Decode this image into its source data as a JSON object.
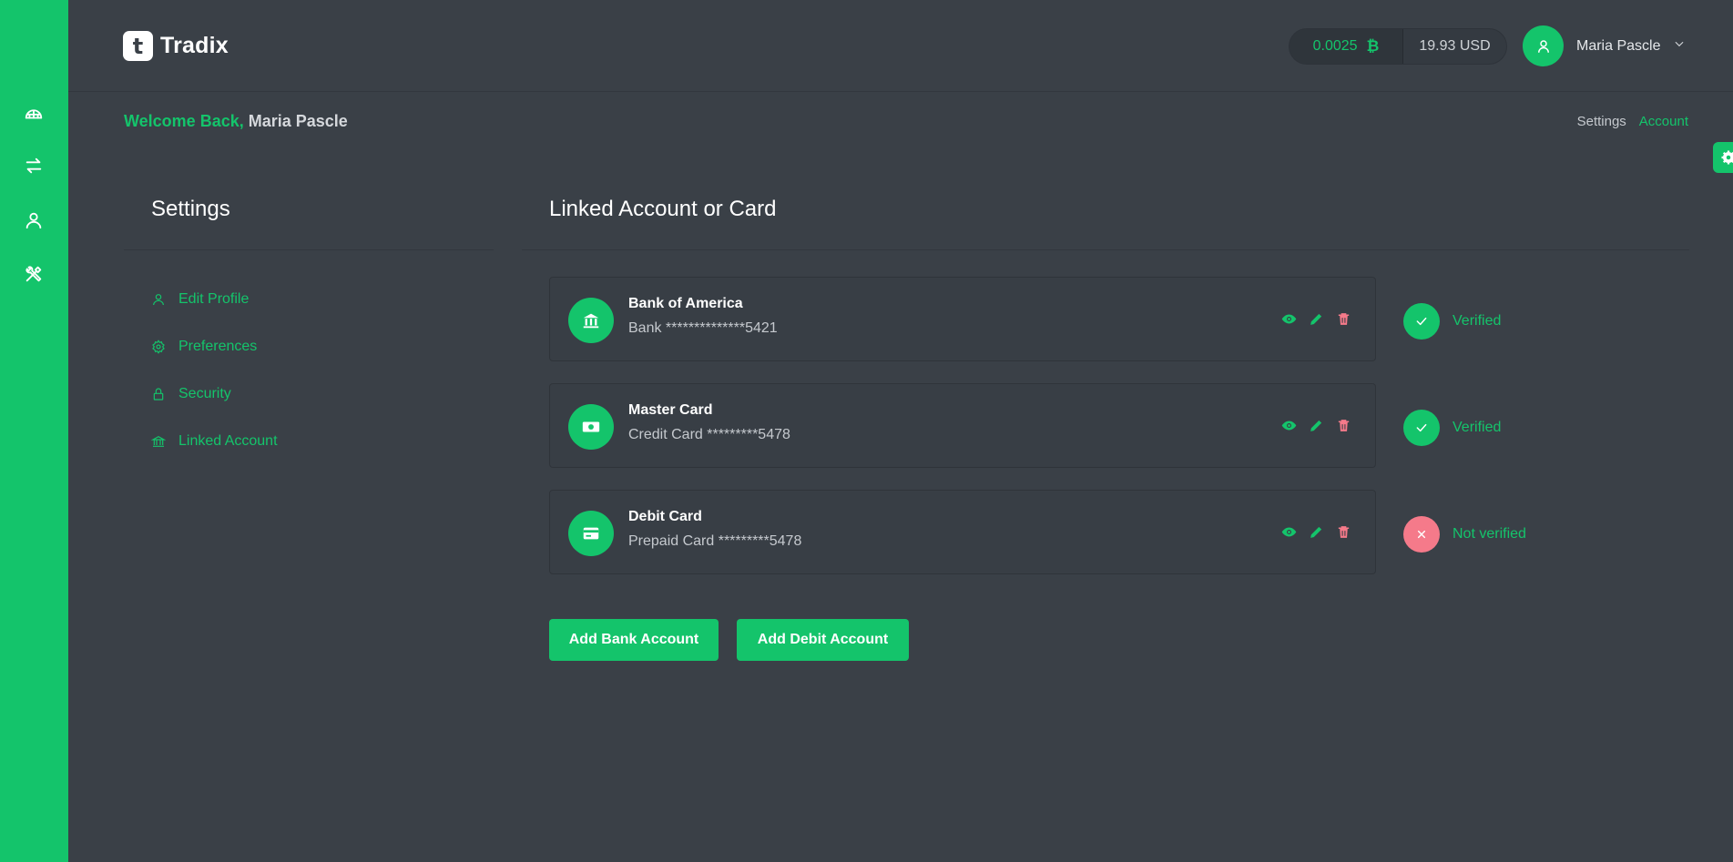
{
  "brand": {
    "mark": "t",
    "name": "Tradix"
  },
  "balance": {
    "btc_amount": "0.0025",
    "btc_symbol": "₿",
    "usd": "19.93 USD"
  },
  "user": {
    "name": "Maria Pascle"
  },
  "welcome": {
    "greeting": "Welcome Back,",
    "name": "Maria Pascle"
  },
  "breadcrumb": {
    "items": [
      "Settings",
      "Account"
    ]
  },
  "sidebar": {
    "icons": [
      "dashboard-icon",
      "exchange-icon",
      "user-icon",
      "tools-icon"
    ]
  },
  "settings": {
    "title": "Settings",
    "menu": [
      {
        "label": "Edit Profile",
        "icon": "user-icon"
      },
      {
        "label": "Preferences",
        "icon": "gear-icon"
      },
      {
        "label": "Security",
        "icon": "lock-icon"
      },
      {
        "label": "Linked Account",
        "icon": "bank-icon"
      }
    ]
  },
  "main": {
    "title": "Linked Account or Card",
    "accounts": [
      {
        "name": "Bank of America",
        "detail": "Bank **************5421",
        "icon": "bank-icon",
        "status": "Verified",
        "verified": true
      },
      {
        "name": "Master Card",
        "detail": "Credit Card *********5478",
        "icon": "cash-icon",
        "status": "Verified",
        "verified": true
      },
      {
        "name": "Debit Card",
        "detail": "Prepaid Card *********5478",
        "icon": "card-icon",
        "status": "Not verified",
        "verified": false
      }
    ],
    "buttons": {
      "add_bank": "Add Bank Account",
      "add_debit": "Add Debit Account"
    }
  },
  "colors": {
    "accent": "#14c46b",
    "background": "#3a4047",
    "danger": "#f57a8a"
  }
}
